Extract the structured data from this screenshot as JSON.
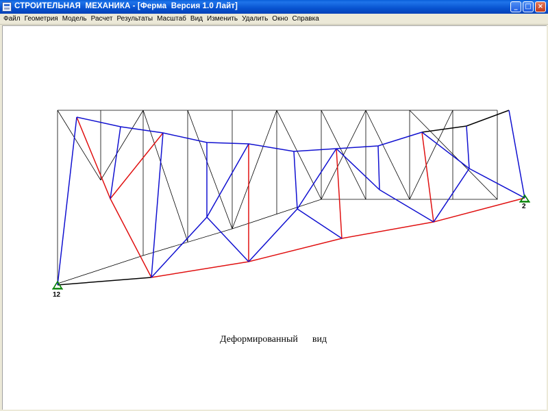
{
  "window": {
    "title": "СТРОИТЕЛЬНАЯ  МЕХАНИКА - [Ферма  Версия 1.0 Лайт]",
    "buttons": {
      "minimize": "_",
      "maximize": "□",
      "close": "×"
    }
  },
  "menu": {
    "items": [
      "Файл",
      "Геометрия",
      "Модель",
      "Расчет",
      "Результаты",
      "Масштаб",
      "Вид",
      "Изменить",
      "Удалить",
      "Окно",
      "Справка"
    ]
  },
  "canvas": {
    "caption": "Деформированный      вид",
    "support_labels": {
      "left": "12",
      "right": "2"
    },
    "colors": {
      "undeformed": "#000000",
      "deformed_blue": "#1010d0",
      "deformed_red": "#e01010",
      "deformed_black": "#000000",
      "support": "#008000"
    }
  }
}
